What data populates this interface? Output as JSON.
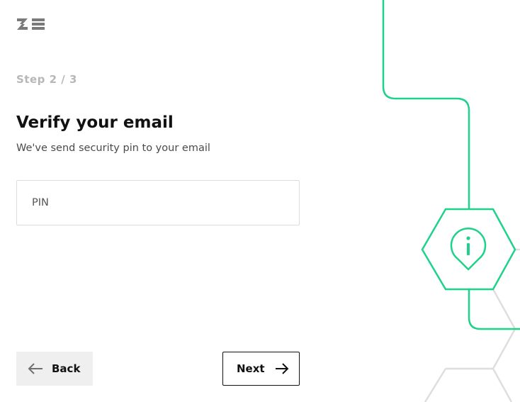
{
  "brand": {
    "logo_icon": "ze-logo-icon"
  },
  "header": {
    "step_text": "Step 2 / 3"
  },
  "main": {
    "title": "Verify your email",
    "subtitle": "We've send security pin to your email",
    "pin_field": {
      "placeholder": "PIN",
      "value": ""
    }
  },
  "footer": {
    "back_label": "Back",
    "back_icon": "arrow-left-icon",
    "next_label": "Next",
    "next_icon": "arrow-right-icon"
  },
  "decoration": {
    "icon": "info-hexagon-icon"
  },
  "colors": {
    "accent": "#1fd28a",
    "muted": "#b7b7b7",
    "text": "#111111",
    "secondary_text": "#4a4a4a",
    "back_bg": "#efefef",
    "hex_outline": "#dedede"
  }
}
